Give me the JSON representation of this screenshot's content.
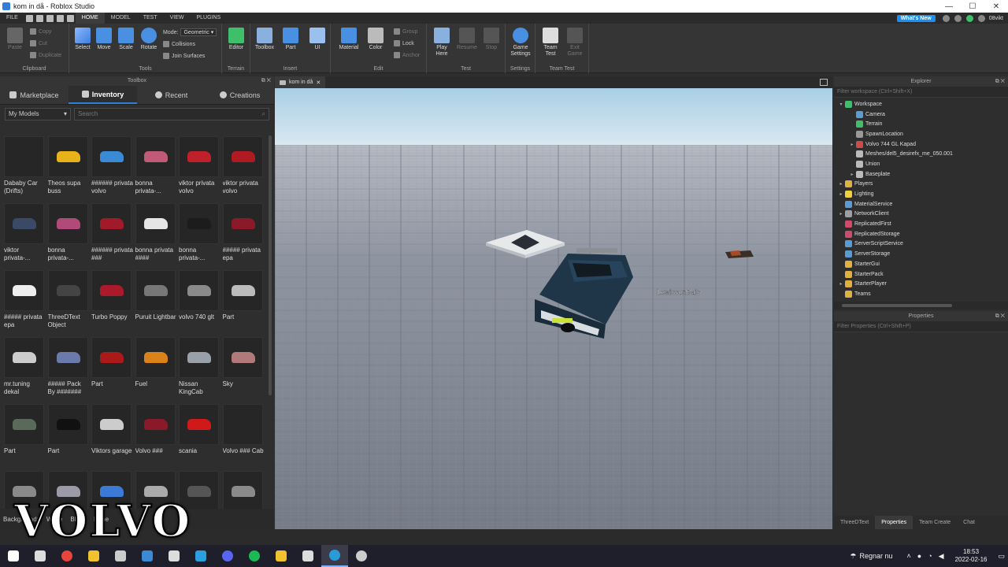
{
  "window": {
    "title": "kom in då - Roblox Studio",
    "minimize": "—",
    "maximize": "☐",
    "close": "✕"
  },
  "menubar": {
    "items": [
      "FILE",
      "HOME",
      "MODEL",
      "TEST",
      "VIEW",
      "PLUGINS"
    ],
    "active": "HOME",
    "whats_new": "What's New",
    "user": "08vikt"
  },
  "ribbon": {
    "clipboard": {
      "label": "Clipboard",
      "paste": "Paste",
      "copy": "Copy",
      "cut": "Cut",
      "duplicate": "Duplicate"
    },
    "tools": {
      "label": "Tools",
      "select": "Select",
      "move": "Move",
      "scale": "Scale",
      "rotate": "Rotate",
      "mode_label": "Mode:",
      "mode_value": "Geometric",
      "collisions": "Collisions",
      "join_surfaces": "Join Surfaces"
    },
    "terrain": {
      "label": "Terrain",
      "editor": "Editor"
    },
    "insert": {
      "label": "Insert",
      "toolbox": "Toolbox",
      "part": "Part",
      "ui": "UI"
    },
    "edit": {
      "label": "Edit",
      "material": "Material",
      "color": "Color",
      "group": "Group",
      "lock": "Lock",
      "anchor": "Anchor"
    },
    "test": {
      "label": "Test",
      "play_here": "Play Here",
      "resume": "Resume",
      "stop": "Stop"
    },
    "settings": {
      "label": "Settings",
      "game_settings": "Game Settings"
    },
    "team_test": {
      "label": "Team Test",
      "team_test": "Team Test",
      "exit_game": "Exit Game"
    }
  },
  "toolbox": {
    "title": "Toolbox",
    "tabs": [
      {
        "label": "Marketplace",
        "icon": "cart-icon"
      },
      {
        "label": "Inventory",
        "icon": "inventory-icon"
      },
      {
        "label": "Recent",
        "icon": "clock-icon"
      },
      {
        "label": "Creations",
        "icon": "bulb-icon"
      }
    ],
    "active_tab": "Inventory",
    "dropdown": "My Models",
    "search_placeholder": "Search",
    "items": [
      {
        "label": "Dababy Car (Drifts)",
        "color": ""
      },
      {
        "label": "Theos supa buss",
        "color": "#e8b21a"
      },
      {
        "label": "###### privata volvo",
        "color": "#3b8ad6"
      },
      {
        "label": "bonna privata-...",
        "color": "#c05a78"
      },
      {
        "label": "viktor privata volvo",
        "color": "#c0202a"
      },
      {
        "label": "viktor privata volvo",
        "color": "#b01a22"
      },
      {
        "label": "viktor privata-...",
        "color": "#3a4a66"
      },
      {
        "label": "bonna privata-...",
        "color": "#b04a78"
      },
      {
        "label": "###### privata ###",
        "color": "#a01a2a"
      },
      {
        "label": "bonna privata ####",
        "color": "#e6e6e6"
      },
      {
        "label": "bonna privata-...",
        "color": "#1c1c1c"
      },
      {
        "label": "##### privata epa",
        "color": "#8a1a2a"
      },
      {
        "label": "##### privata epa",
        "color": "#eeeeee"
      },
      {
        "label": "ThreeDText Object",
        "color": "#444444"
      },
      {
        "label": "Turbo Poppy",
        "color": "#aa1a2a"
      },
      {
        "label": "Puruit Lightbar",
        "color": "#777777"
      },
      {
        "label": "volvo 740 glt",
        "color": "#8a8a8a"
      },
      {
        "label": "Part",
        "color": "#bbbbbb"
      },
      {
        "label": "mr.tuning dekal",
        "color": "#cccccc"
      },
      {
        "label": "##### Pack By #######",
        "color": "#6a7aaa"
      },
      {
        "label": "Part",
        "color": "#aa1a1a"
      },
      {
        "label": "Fuel",
        "color": "#d9821a"
      },
      {
        "label": "Nissan KingCab",
        "color": "#9aa0a8"
      },
      {
        "label": "Sky",
        "color": "#b07a7a"
      },
      {
        "label": "Part",
        "color": "#5a6a5a"
      },
      {
        "label": "Part",
        "color": "#111111"
      },
      {
        "label": "Viktors garage",
        "color": "#cccccc"
      },
      {
        "label": "Volvo ###",
        "color": "#8a1a2a"
      },
      {
        "label": "scania",
        "color": "#d01a1a"
      },
      {
        "label": "Volvo ### Cab",
        "color": ""
      },
      {
        "label": "",
        "color": "#8a8a8a"
      },
      {
        "label": "",
        "color": "#9a9aa8"
      },
      {
        "label": "",
        "color": "#3b7ad6"
      },
      {
        "label": "",
        "color": "#aaaaaa"
      },
      {
        "label": "",
        "color": "#555555"
      },
      {
        "label": "",
        "color": "#8a8a8a"
      }
    ],
    "background_label": "Background:",
    "bg_options": [
      "White",
      "Black",
      "None"
    ]
  },
  "viewport": {
    "tab_label": "kom in då",
    "player_tag": "LewissonBajs"
  },
  "explorer": {
    "title": "Explorer",
    "filter_placeholder": "Filter workspace (Ctrl+Shift+X)",
    "items": [
      {
        "label": "Workspace",
        "depth": 0,
        "arrow": "▾",
        "color": "#3fbf6a"
      },
      {
        "label": "Camera",
        "depth": 1,
        "arrow": "",
        "color": "#5b9bd5"
      },
      {
        "label": "Terrain",
        "depth": 1,
        "arrow": "",
        "color": "#3fbf6a"
      },
      {
        "label": "SpawnLocation",
        "depth": 1,
        "arrow": "",
        "color": "#999999"
      },
      {
        "label": "Volvo 744 GL Kapad",
        "depth": 1,
        "arrow": "▸",
        "color": "#d04a4a"
      },
      {
        "label": "Meshes/del5_desirefx_me_050.001",
        "depth": 1,
        "arrow": "",
        "color": "#bbbbbb"
      },
      {
        "label": "Union",
        "depth": 1,
        "arrow": "",
        "color": "#bbbbbb"
      },
      {
        "label": "Baseplate",
        "depth": 1,
        "arrow": "▸",
        "color": "#bbbbbb"
      },
      {
        "label": "Players",
        "depth": 0,
        "arrow": "▸",
        "color": "#e0b040"
      },
      {
        "label": "Lighting",
        "depth": 0,
        "arrow": "▸",
        "color": "#f0d040"
      },
      {
        "label": "MaterialService",
        "depth": 0,
        "arrow": "",
        "color": "#5b9bd5"
      },
      {
        "label": "NetworkClient",
        "depth": 0,
        "arrow": "▸",
        "color": "#9aa0a8"
      },
      {
        "label": "ReplicatedFirst",
        "depth": 0,
        "arrow": "",
        "color": "#d04a6a"
      },
      {
        "label": "ReplicatedStorage",
        "depth": 0,
        "arrow": "",
        "color": "#d04a6a"
      },
      {
        "label": "ServerScriptService",
        "depth": 0,
        "arrow": "",
        "color": "#5b9bd5"
      },
      {
        "label": "ServerStorage",
        "depth": 0,
        "arrow": "",
        "color": "#5b9bd5"
      },
      {
        "label": "StarterGui",
        "depth": 0,
        "arrow": "",
        "color": "#e0b040"
      },
      {
        "label": "StarterPack",
        "depth": 0,
        "arrow": "",
        "color": "#e0b040"
      },
      {
        "label": "StarterPlayer",
        "depth": 0,
        "arrow": "▸",
        "color": "#e0b040"
      },
      {
        "label": "Teams",
        "depth": 0,
        "arrow": "",
        "color": "#e0b040"
      }
    ]
  },
  "properties": {
    "title": "Properties",
    "filter_placeholder": "Filter Properties (Ctrl+Shift+P)"
  },
  "bottom_tabs": [
    "ThreeDText",
    "Properties",
    "Team Create",
    "Chat"
  ],
  "bottom_active": "Properties",
  "watermark": "VOLVO",
  "taskbar": {
    "weather": "Regnar nu",
    "time": "18:53",
    "date": "2022-02-16",
    "apps": [
      {
        "name": "windows-start-icon",
        "color": "#ffffff"
      },
      {
        "name": "task-view-icon",
        "color": "#dddddd"
      },
      {
        "name": "chrome-icon",
        "color": "#e8453c"
      },
      {
        "name": "file-explorer-icon",
        "color": "#f2c12e"
      },
      {
        "name": "store-icon",
        "color": "#cccccc"
      },
      {
        "name": "roblox-studio-icon",
        "color": "#3b8ad6"
      },
      {
        "name": "roblox-icon",
        "color": "#dddddd"
      },
      {
        "name": "visual-studio-icon",
        "color": "#2aa0e0"
      },
      {
        "name": "discord-icon",
        "color": "#5865f2"
      },
      {
        "name": "spotify-icon",
        "color": "#1db954"
      },
      {
        "name": "notes-icon",
        "color": "#f2c12e"
      },
      {
        "name": "inkscape-icon",
        "color": "#dddddd"
      },
      {
        "name": "edge-icon",
        "color": "#2a9ad8"
      },
      {
        "name": "obs-icon",
        "color": "#cccccc"
      }
    ]
  }
}
